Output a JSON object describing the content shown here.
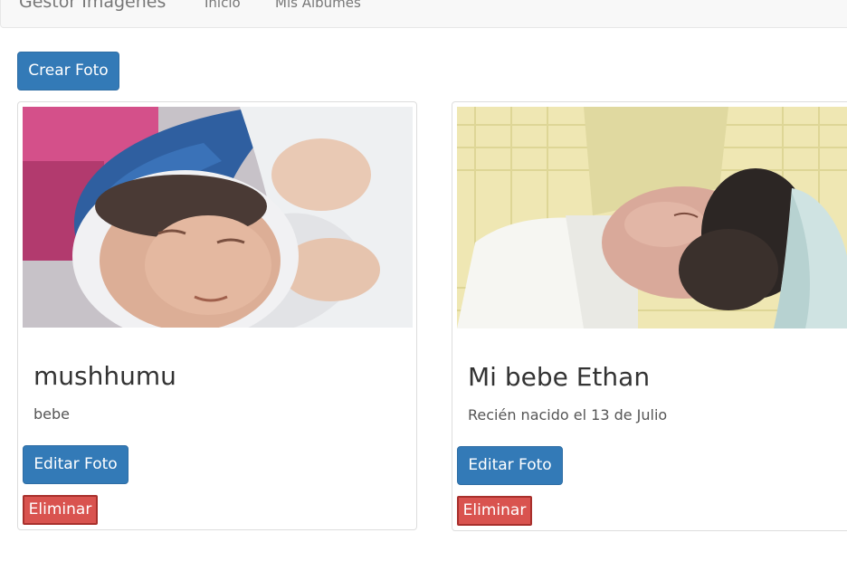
{
  "navbar": {
    "brand": "Gestor Imagenes",
    "links": [
      "Inicio",
      "Mis Albumes"
    ]
  },
  "actions": {
    "create_photo": "Crear Foto"
  },
  "photos": [
    {
      "title": "mushhumu",
      "description": "bebe",
      "image_alt": "sleeping newborn baby wrapped in blue and white blanket",
      "edit_label": "Editar Foto",
      "delete_label": "Eliminar"
    },
    {
      "title": "Mi bebe Ethan",
      "description": "Recién nacido el 13 de Julio",
      "image_alt": "sleeping newborn baby with light blue cap on yellow blanket",
      "edit_label": "Editar Foto",
      "delete_label": "Eliminar"
    }
  ],
  "colors": {
    "primary": "#337ab7",
    "danger": "#d9534f",
    "navbar_bg": "#f8f8f8"
  }
}
